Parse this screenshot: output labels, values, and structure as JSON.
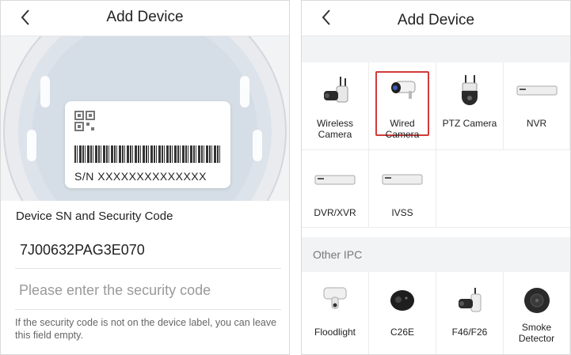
{
  "left": {
    "title": "Add Device",
    "label_sn": "S/N  XXXXXXXXXXXXXX",
    "field_label": "Device SN and Security Code",
    "sn_value": "7J00632PAG3E070",
    "security_placeholder": "Please enter the security code",
    "hint": "If the security code is not on the device label, you can leave this field empty."
  },
  "right": {
    "title": "Add Device",
    "devices": [
      {
        "label": "Wireless Camera",
        "icon": "wireless-camera-icon"
      },
      {
        "label": "Wired Camera",
        "icon": "wired-camera-icon",
        "selected": true
      },
      {
        "label": "PTZ Camera",
        "icon": "ptz-camera-icon"
      },
      {
        "label": "NVR",
        "icon": "nvr-icon"
      },
      {
        "label": "DVR/XVR",
        "icon": "dvr-icon"
      },
      {
        "label": "IVSS",
        "icon": "ivss-icon"
      }
    ],
    "other_section": "Other IPC",
    "other_devices": [
      {
        "label": "Floodlight",
        "icon": "floodlight-icon"
      },
      {
        "label": "C26E",
        "icon": "c26e-camera-icon"
      },
      {
        "label": "F46/F26",
        "icon": "f46-camera-icon"
      },
      {
        "label": "Smoke Detector",
        "icon": "smoke-detector-icon"
      }
    ],
    "highlight_color": "#d33a3a"
  }
}
